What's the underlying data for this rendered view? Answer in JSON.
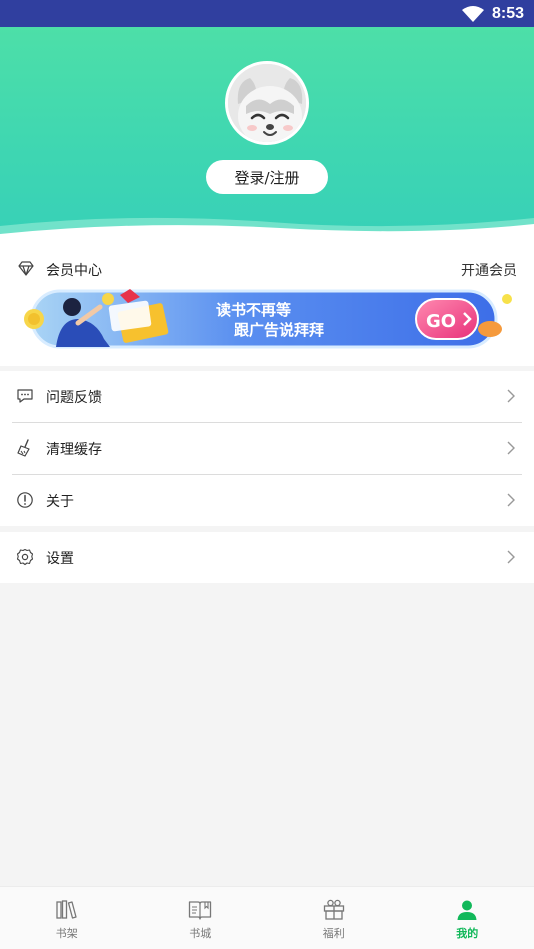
{
  "status_bar": {
    "time": "8:53",
    "wifi_icon": "wifi-icon"
  },
  "header": {
    "login_label": "登录/注册"
  },
  "member": {
    "title": "会员中心",
    "open_label": "开通会员",
    "banner": {
      "line1": "读书不再等",
      "line2": "跟广告说拜拜",
      "go": "GO"
    }
  },
  "menu": {
    "items": [
      {
        "label": "问题反馈",
        "icon": "chat-icon"
      },
      {
        "label": "清理缓存",
        "icon": "broom-icon"
      },
      {
        "label": "关于",
        "icon": "info-icon"
      }
    ],
    "settings_label": "设置"
  },
  "bottom_nav": {
    "items": [
      {
        "label": "书架",
        "icon": "bookshelf-icon"
      },
      {
        "label": "书城",
        "icon": "open-book-icon"
      },
      {
        "label": "福利",
        "icon": "gift-icon"
      },
      {
        "label": "我的",
        "icon": "person-icon",
        "active": true
      }
    ],
    "active_color": "#11b85a"
  },
  "colors": {
    "status_bar": "#303f9f",
    "header_top": "#4ddfa8",
    "header_bottom": "#37d0b8",
    "accent": "#11b85a"
  }
}
